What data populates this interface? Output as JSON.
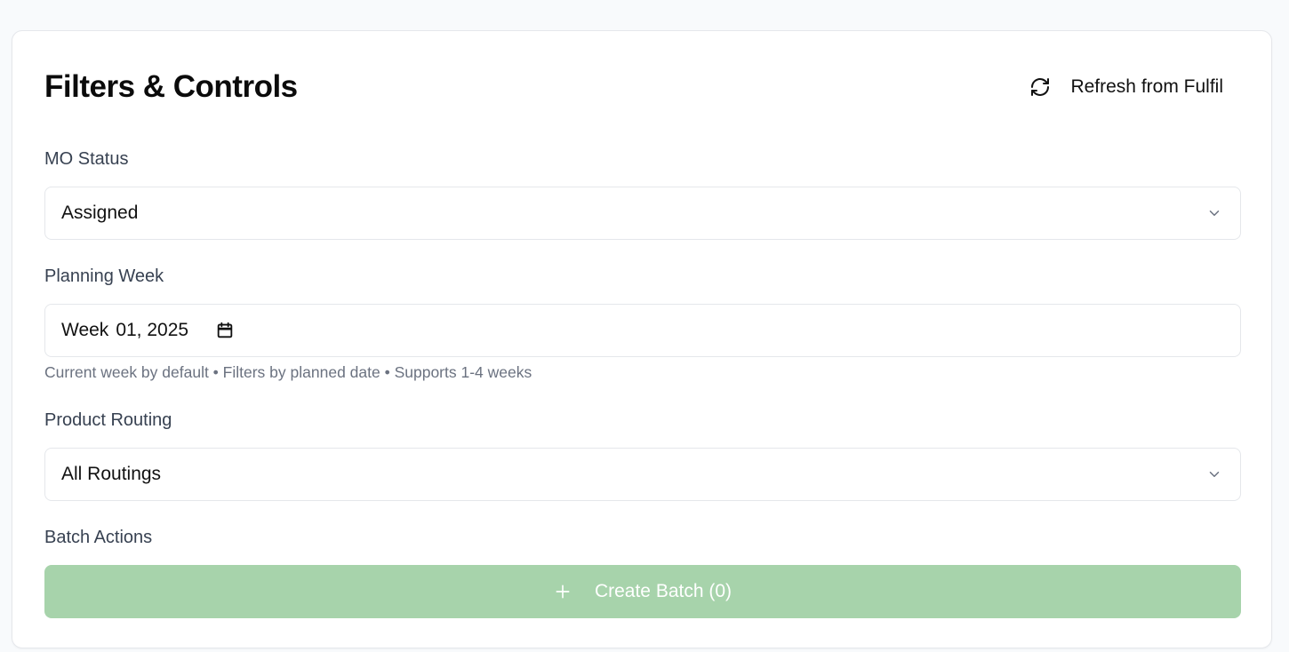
{
  "panel": {
    "title": "Filters & Controls",
    "refresh_label": "Refresh from Fulfil"
  },
  "mo_status": {
    "label": "MO Status",
    "selected": "Assigned"
  },
  "planning_week": {
    "label": "Planning Week",
    "week_word": "Week",
    "value": "01, 2025",
    "helper": "Current week by default • Filters by planned date • Supports 1-4 weeks"
  },
  "product_routing": {
    "label": "Product Routing",
    "selected": "All Routings"
  },
  "batch_actions": {
    "label": "Batch Actions",
    "create_label": "Create Batch (0)",
    "disabled": true,
    "button_color": "#a7d3ab"
  },
  "icons": {
    "refresh": "refresh-icon",
    "chevron": "chevron-down-icon",
    "calendar": "calendar-icon",
    "plus": "plus-icon"
  }
}
